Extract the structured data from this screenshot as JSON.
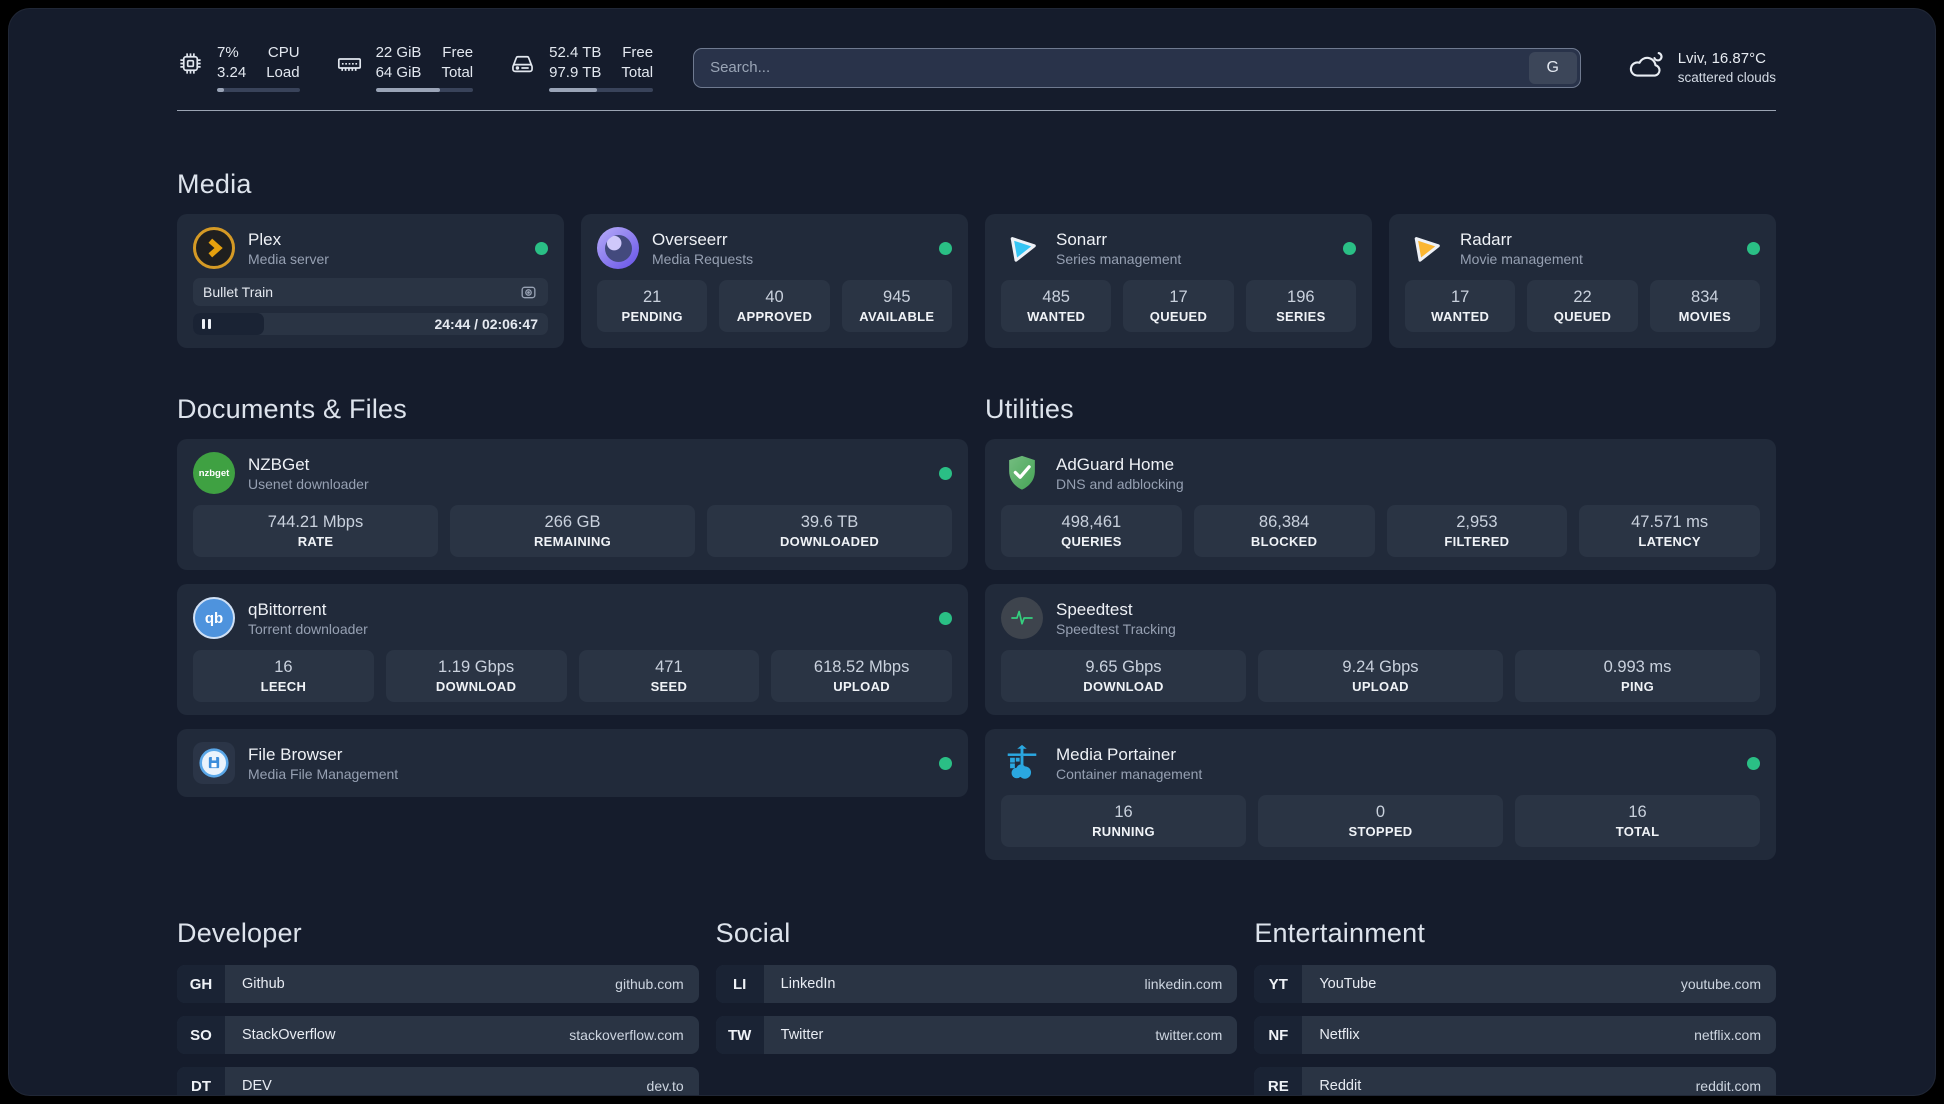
{
  "header": {
    "system_stats": [
      {
        "icon": "cpu-icon",
        "value_top": "7%",
        "value_bottom": "3.24",
        "label_top": "CPU",
        "label_bottom": "Load",
        "progress_percent": 8
      },
      {
        "icon": "ram-icon",
        "value_top": "22 GiB",
        "value_bottom": "64 GiB",
        "label_top": "Free",
        "label_bottom": "Total",
        "progress_percent": 66
      },
      {
        "icon": "disk-icon",
        "value_top": "52.4 TB",
        "value_bottom": "97.9 TB",
        "label_top": "Free",
        "label_bottom": "Total",
        "progress_percent": 46
      }
    ],
    "search": {
      "placeholder": "Search...",
      "button_label": "G"
    },
    "weather": {
      "icon": "cloud-icon",
      "location": "Lviv, 16.87°C",
      "condition": "scattered clouds"
    }
  },
  "media": {
    "title": "Media",
    "cards": [
      {
        "icon": "plex-icon",
        "name": "Plex",
        "subtitle": "Media server",
        "online": true,
        "player": {
          "title": "Bullet Train",
          "time": "24:44 / 02:06:47",
          "progress_percent": 20
        }
      },
      {
        "icon": "overseerr-icon",
        "name": "Overseerr",
        "subtitle": "Media Requests",
        "online": true,
        "stats": [
          {
            "value": "21",
            "label": "PENDING"
          },
          {
            "value": "40",
            "label": "APPROVED"
          },
          {
            "value": "945",
            "label": "AVAILABLE"
          }
        ]
      },
      {
        "icon": "sonarr-icon",
        "name": "Sonarr",
        "subtitle": "Series management",
        "online": true,
        "stats": [
          {
            "value": "485",
            "label": "WANTED"
          },
          {
            "value": "17",
            "label": "QUEUED"
          },
          {
            "value": "196",
            "label": "SERIES"
          }
        ]
      },
      {
        "icon": "radarr-icon",
        "name": "Radarr",
        "subtitle": "Movie management",
        "online": true,
        "stats": [
          {
            "value": "17",
            "label": "WANTED"
          },
          {
            "value": "22",
            "label": "QUEUED"
          },
          {
            "value": "834",
            "label": "MOVIES"
          }
        ]
      }
    ]
  },
  "documents": {
    "title": "Documents & Files",
    "cards": [
      {
        "icon": "nzbget-icon",
        "icon_text": "nzbget",
        "name": "NZBGet",
        "subtitle": "Usenet downloader",
        "online": true,
        "stats": [
          {
            "value": "744.21 Mbps",
            "label": "RATE"
          },
          {
            "value": "266 GB",
            "label": "REMAINING"
          },
          {
            "value": "39.6 TB",
            "label": "DOWNLOADED"
          }
        ]
      },
      {
        "icon": "qbittorrent-icon",
        "icon_text": "qb",
        "name": "qBittorrent",
        "subtitle": "Torrent downloader",
        "online": true,
        "stats": [
          {
            "value": "16",
            "label": "LEECH"
          },
          {
            "value": "1.19 Gbps",
            "label": "DOWNLOAD"
          },
          {
            "value": "471",
            "label": "SEED"
          },
          {
            "value": "618.52 Mbps",
            "label": "UPLOAD"
          }
        ]
      },
      {
        "icon": "filebrowser-icon",
        "name": "File Browser",
        "subtitle": "Media File Management",
        "online": true,
        "stats": []
      }
    ]
  },
  "utilities": {
    "title": "Utilities",
    "cards": [
      {
        "icon": "adguard-icon",
        "name": "AdGuard Home",
        "subtitle": "DNS and adblocking",
        "stats": [
          {
            "value": "498,461",
            "label": "QUERIES"
          },
          {
            "value": "86,384",
            "label": "BLOCKED"
          },
          {
            "value": "2,953",
            "label": "FILTERED"
          },
          {
            "value": "47.571 ms",
            "label": "LATENCY"
          }
        ]
      },
      {
        "icon": "speedtest-icon",
        "name": "Speedtest",
        "subtitle": "Speedtest Tracking",
        "stats": [
          {
            "value": "9.65 Gbps",
            "label": "DOWNLOAD"
          },
          {
            "value": "9.24 Gbps",
            "label": "UPLOAD"
          },
          {
            "value": "0.993 ms",
            "label": "PING"
          }
        ]
      },
      {
        "icon": "portainer-icon",
        "name": "Media Portainer",
        "subtitle": "Container management",
        "online": true,
        "stats": [
          {
            "value": "16",
            "label": "RUNNING"
          },
          {
            "value": "0",
            "label": "STOPPED"
          },
          {
            "value": "16",
            "label": "TOTAL"
          }
        ]
      }
    ]
  },
  "bookmarks": [
    {
      "title": "Developer",
      "links": [
        {
          "abbr": "GH",
          "name": "Github",
          "url": "github.com"
        },
        {
          "abbr": "SO",
          "name": "StackOverflow",
          "url": "stackoverflow.com"
        },
        {
          "abbr": "DT",
          "name": "DEV",
          "url": "dev.to"
        }
      ]
    },
    {
      "title": "Social",
      "links": [
        {
          "abbr": "LI",
          "name": "LinkedIn",
          "url": "linkedin.com"
        },
        {
          "abbr": "TW",
          "name": "Twitter",
          "url": "twitter.com"
        }
      ]
    },
    {
      "title": "Entertainment",
      "links": [
        {
          "abbr": "YT",
          "name": "YouTube",
          "url": "youtube.com"
        },
        {
          "abbr": "NF",
          "name": "Netflix",
          "url": "netflix.com"
        },
        {
          "abbr": "RE",
          "name": "Reddit",
          "url": "reddit.com"
        }
      ]
    }
  ],
  "colors": {
    "page_background": "#151c2c",
    "card_background": "#212a3a",
    "box_background": "#2a3444",
    "status_online": "#2abf85",
    "plex_orange": "#e5a00d",
    "sonarr_cyan": "#35c5f4",
    "radarr_amber": "#fbb632",
    "nzbget_green": "#3fa142",
    "qbittorrent_blue": "#4e93dd",
    "portainer_blue": "#2aa7e0"
  }
}
